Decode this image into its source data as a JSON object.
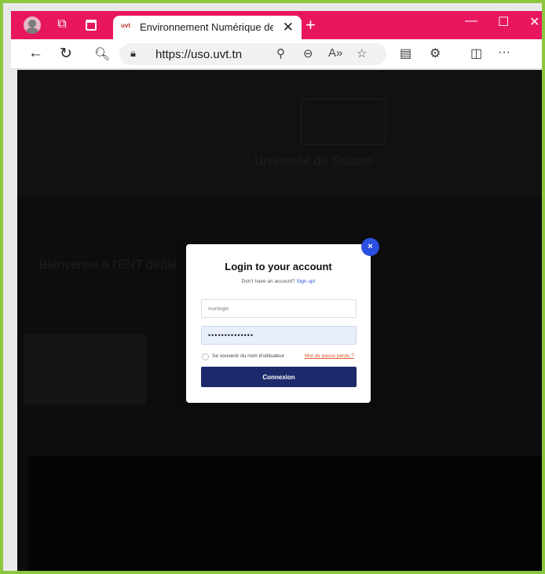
{
  "browser": {
    "tab_title": "Environnement Numérique de Tr",
    "favicon_text": "uvt",
    "url": "https://uso.uvt.tn",
    "tab_close_icon": "✕",
    "new_tab_icon": "+",
    "window_controls": {
      "minimize": "—",
      "maximize": "☐",
      "close": "✕"
    },
    "nav_icons": {
      "back": "←",
      "refresh": "↻",
      "search": "🔍︎"
    },
    "address_icons": {
      "lock": "🔒︎",
      "key": "⚲",
      "zoom": "⊖",
      "read_aloud": "A»",
      "favorite": "☆"
    },
    "toolbar_icons": {
      "collections": "▤",
      "extensions": "⚙",
      "split": "◫",
      "more": "···"
    }
  },
  "page": {
    "hero_subtitle": "Université de Sousse",
    "welcome_text": "Bienvenue à l'ENT dédié"
  },
  "modal": {
    "close_icon": "×",
    "title": "Login to your account",
    "signup_prompt": "Don't have an account?",
    "signup_link": "Sign up!",
    "login_placeholder": "monlogin",
    "password_value": "••••••••••••••",
    "remember_label": "Se souvenir du nom d'utilisateur",
    "forgot_link": "Mot de passe perdu ?",
    "submit_label": "Connexion"
  },
  "colors": {
    "titlebar": "#e7165f",
    "frame_border": "#8dc63f",
    "button": "#1c2a6b",
    "close_button": "#2b4fe0",
    "forgot_link": "#e25a2b"
  }
}
